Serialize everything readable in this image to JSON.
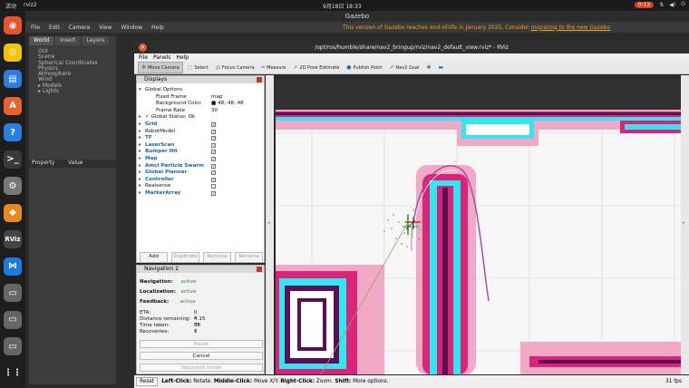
{
  "topbar": {
    "activities": "活动",
    "app": "rviz2",
    "clock": "9月18日 18:33",
    "battery": "0:13"
  },
  "dock": [
    {
      "name": "firefox-icon",
      "color": "#e8562a",
      "glyph": "◉"
    },
    {
      "name": "rhythmbox-icon",
      "color": "#f4c20d",
      "glyph": "◎"
    },
    {
      "name": "writer-icon",
      "color": "#2a7de1",
      "glyph": "▤"
    },
    {
      "name": "app-center-icon",
      "color": "#e9622a",
      "glyph": "A"
    },
    {
      "name": "help-icon",
      "color": "#2a7de1",
      "glyph": "?"
    },
    {
      "name": "terminal-icon",
      "color": "#3a3a3a",
      "glyph": ">_"
    },
    {
      "name": "settings-icon",
      "color": "#777",
      "glyph": "⚙"
    },
    {
      "name": "gazebo-icon",
      "color": "#e88a1a",
      "glyph": "◆"
    },
    {
      "name": "rviz-icon",
      "color": "#444",
      "glyph": "RViz"
    },
    {
      "name": "vscode-icon",
      "color": "#1f7bd8",
      "glyph": "⋈"
    },
    {
      "name": "disk-icon-1",
      "color": "#666",
      "glyph": "▭"
    },
    {
      "name": "disk-icon-2",
      "color": "#666",
      "glyph": "▭"
    },
    {
      "name": "disk-icon-3",
      "color": "#666",
      "glyph": "▭"
    },
    {
      "name": "show-apps-icon",
      "color": "#1e1e1e",
      "glyph": "⋮⋮"
    }
  ],
  "gazebo": {
    "title": "Gazebo",
    "menu": [
      "File",
      "Edit",
      "Camera",
      "View",
      "Window",
      "Help"
    ],
    "warning": "This version of Gazebo reaches end-of-life in January 2025. Consider ",
    "warning_link": "migrating to the new Gazebo",
    "tabs": [
      "World",
      "Insert",
      "Layers"
    ],
    "tree": [
      "GUI",
      "Scene",
      "Spherical Coordinates",
      "Physics",
      "Atmosphere",
      "Wind",
      "▸ Models",
      "▸ Lights"
    ],
    "prop_cols": [
      "Property",
      "Value"
    ]
  },
  "rviz": {
    "title": "/opt/ros/humble/share/nav2_bringup/rviz/nav2_default_view.rviz* - RViz",
    "menu": [
      "File",
      "Panels",
      "Help"
    ],
    "tools": [
      {
        "label": "Move Camera",
        "icon": "move-camera-icon",
        "glyph": "✥",
        "active": true
      },
      {
        "label": "Select",
        "icon": "select-icon",
        "glyph": "⬚",
        "active": false
      },
      {
        "label": "Focus Camera",
        "icon": "focus-camera-icon",
        "glyph": "◎",
        "active": false
      },
      {
        "label": "Measure",
        "icon": "measure-icon",
        "glyph": "━",
        "active": false
      },
      {
        "label": "2D Pose Estimate",
        "icon": "pose-estimate-icon",
        "glyph": "➚",
        "active": false
      },
      {
        "label": "Publish Point",
        "icon": "publish-point-icon",
        "glyph": "●",
        "active": false
      },
      {
        "label": "Nav2 Goal",
        "icon": "nav2-goal-icon",
        "glyph": "➚",
        "active": false
      },
      {
        "label": "",
        "icon": "plus-icon",
        "glyph": "✚",
        "active": false
      },
      {
        "label": "",
        "icon": "minus-icon",
        "glyph": "▬",
        "active": false
      }
    ],
    "displays": {
      "title": "Displays",
      "rows": [
        {
          "label": "Global Options",
          "indent": 1,
          "arrow": "▾",
          "blue": false,
          "value": "",
          "check": null
        },
        {
          "label": "Fixed Frame",
          "indent": 2,
          "arrow": "",
          "blue": false,
          "value": "map",
          "check": null
        },
        {
          "label": "Background Color",
          "indent": 2,
          "arrow": "",
          "blue": false,
          "value": "■ 48; 48; 48",
          "check": null
        },
        {
          "label": "Frame Rate",
          "indent": 2,
          "arrow": "",
          "blue": false,
          "value": "30",
          "check": null
        },
        {
          "label": "✓ Global Status: Ok",
          "indent": 1,
          "arrow": "▸",
          "blue": false,
          "value": "",
          "check": null
        },
        {
          "label": "Grid",
          "indent": 1,
          "arrow": "▸",
          "blue": true,
          "value": "",
          "check": true
        },
        {
          "label": "RobotModel",
          "indent": 1,
          "arrow": "▸",
          "blue": false,
          "value": "",
          "check": true
        },
        {
          "label": "TF",
          "indent": 1,
          "arrow": "▸",
          "blue": true,
          "value": "",
          "check": true
        },
        {
          "label": "LaserScan",
          "indent": 1,
          "arrow": "▸",
          "blue": true,
          "value": "",
          "check": true
        },
        {
          "label": "Bumper Hit",
          "indent": 1,
          "arrow": "▸",
          "blue": true,
          "value": "",
          "check": true
        },
        {
          "label": "Map",
          "indent": 1,
          "arrow": "▸",
          "blue": true,
          "value": "",
          "check": true
        },
        {
          "label": "Amcl Particle Swarm",
          "indent": 1,
          "arrow": "▸",
          "blue": true,
          "value": "",
          "check": true
        },
        {
          "label": "Global Planner",
          "indent": 1,
          "arrow": "▸",
          "blue": true,
          "value": "",
          "check": true
        },
        {
          "label": "Controller",
          "indent": 1,
          "arrow": "▸",
          "blue": true,
          "value": "",
          "check": true
        },
        {
          "label": "Realsense",
          "indent": 1,
          "arrow": "▸",
          "blue": false,
          "value": "",
          "check": false
        },
        {
          "label": "MarkerArray",
          "indent": 1,
          "arrow": "▸",
          "blue": true,
          "value": "",
          "check": true
        }
      ],
      "buttons": [
        {
          "label": "Add",
          "active": true
        },
        {
          "label": "Duplicate",
          "active": false
        },
        {
          "label": "Remove",
          "active": false
        },
        {
          "label": "Rename",
          "active": false
        }
      ]
    },
    "nav2": {
      "title": "Navigation 2",
      "navigation_label": "Navigation:",
      "navigation_value": "active",
      "localization_label": "Localization:",
      "localization_value": "active",
      "feedback_label": "Feedback:",
      "feedback_value": "active",
      "eta_label": "ETA:",
      "eta_value": "0 s",
      "distance_label": "Distance remaining:",
      "distance_value": "4.15 m",
      "time_label": "Time taken:",
      "time_value": "38 s",
      "recoveries_label": "Recoveries:",
      "recoveries_value": "1",
      "pause_label": "Pause",
      "cancel_label": "Cancel",
      "waypoint_label": "Waypoint mode"
    },
    "status": {
      "reset": "Reset",
      "hint_left_b": "Left-Click:",
      "hint_left": " Rotate. ",
      "hint_mid_b": "Middle-Click:",
      "hint_mid": " Move X/Y. ",
      "hint_right_b": "Right-Click:",
      "hint_right": " Zoom. ",
      "hint_shift_b": "Shift:",
      "hint_shift": " More options.",
      "fps": "31 fps"
    }
  },
  "colors": {
    "map_free": "#f5f5f5",
    "costmap_magenta": "#d8257a",
    "costmap_pink": "#f2a9c6",
    "inflation_cyan": "#33e6f0",
    "lethal_purple": "#5a0f55",
    "path_purple": "#a8449e"
  }
}
